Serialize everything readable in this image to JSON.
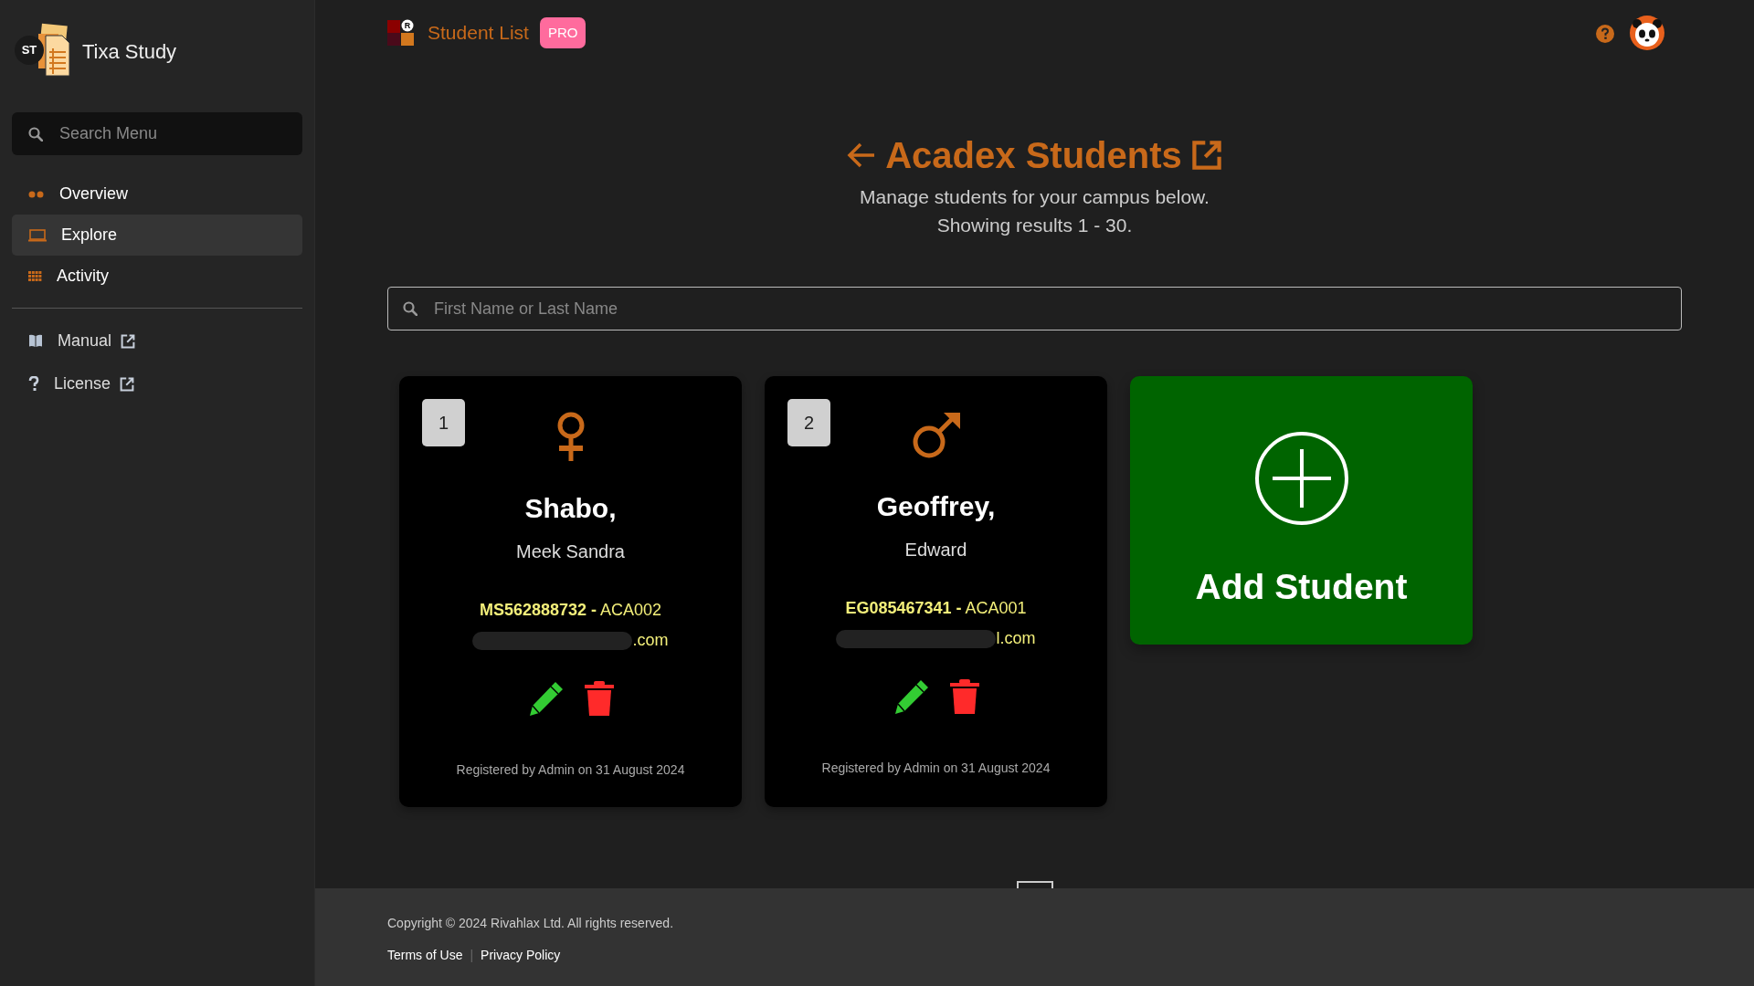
{
  "sidebar": {
    "brand": "Tixa Study",
    "logo_text": "ST",
    "search": {
      "placeholder": "Search Menu"
    },
    "items": [
      {
        "label": "Overview",
        "kind": "dots",
        "selected": false
      },
      {
        "label": "Explore",
        "kind": "laptop",
        "selected": true
      },
      {
        "label": "Activity",
        "kind": "grid",
        "selected": false
      }
    ],
    "links": [
      {
        "label": "Manual",
        "kind": "book",
        "external": true
      },
      {
        "label": "License",
        "kind": "question",
        "external": true
      }
    ]
  },
  "header": {
    "logo_letter": "R",
    "title": "Student List",
    "badge": "PRO"
  },
  "page": {
    "title": "Acadex Students",
    "subtitle_lines": [
      "Manage students for your campus below.",
      "Showing results 1 - 30."
    ]
  },
  "search": {
    "placeholder": "First Name or Last Name"
  },
  "students": [
    {
      "number": "1",
      "kind": "female",
      "surname": "Shabo,",
      "given_names": "Meek Sandra",
      "code_line": "**MS562888732 -** ACA002",
      "email": ".com",
      "registered": "Registered by Admin on 31 August 2024"
    },
    {
      "number": "2",
      "kind": "male",
      "surname": "Geoffrey,",
      "given_names": "Edward",
      "code_line": "**EG085467341 -** ACA001",
      "email": "l.com",
      "registered": "Registered by Admin on 31 August 2024"
    }
  ],
  "add_card": {
    "label": "Add Student"
  },
  "footer": {
    "copyright": "Copyright © 2024 Rivahlax Ltd. All rights reserved.",
    "links": [
      "Terms of Use",
      "Privacy Policy"
    ],
    "separator": "|"
  }
}
